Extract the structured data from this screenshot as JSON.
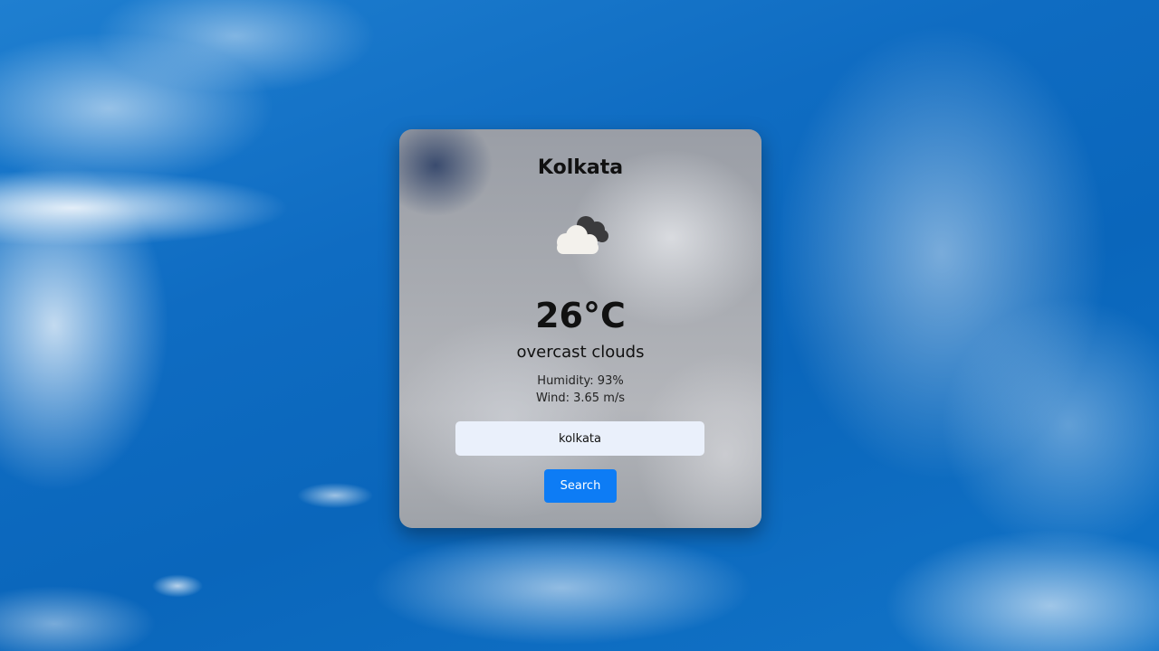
{
  "weather": {
    "city": "Kolkata",
    "icon": "overcast-clouds-icon",
    "temperature": "26°C",
    "description": "overcast clouds",
    "humidity": "Humidity: 93%",
    "wind": "Wind: 3.65 m/s"
  },
  "search": {
    "value": "kolkata",
    "button_label": "Search"
  },
  "colors": {
    "button": "#0d7cf5",
    "input_background": "#eaf0fb"
  }
}
